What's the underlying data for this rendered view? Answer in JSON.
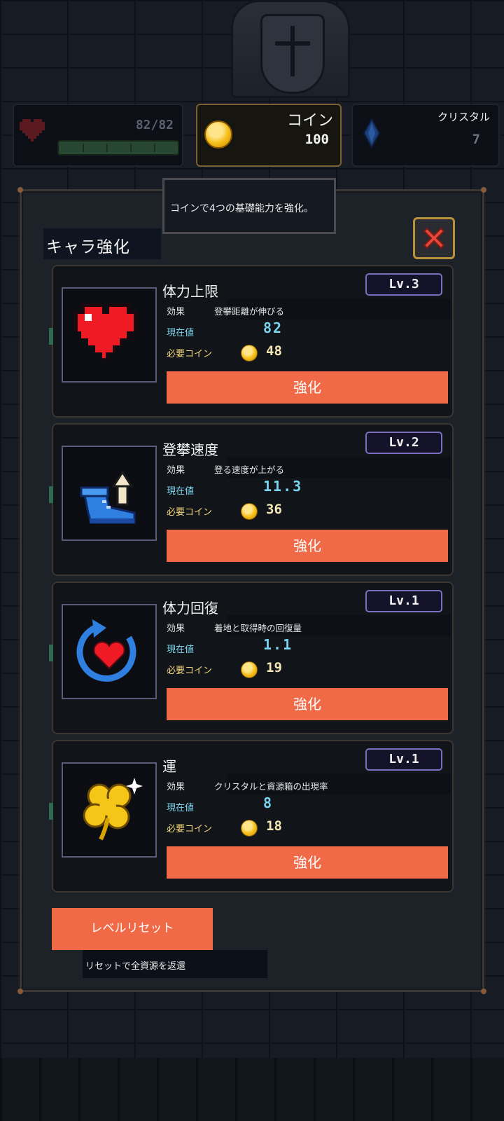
{
  "hud": {
    "hp": "82/82",
    "coin_label": "コイン",
    "coin_value": "100",
    "crystal_label": "クリスタル",
    "crystal_value": "7"
  },
  "tooltip": "コインで4つの基礎能力を強化。",
  "panel": {
    "title": "キャラ強化",
    "labels": {
      "effect": "効果",
      "current": "現在値",
      "cost": "必要コイン",
      "upgrade": "強化"
    },
    "cards": [
      {
        "name": "体力上限",
        "level": "Lv.3",
        "effect": "登攀距離が伸びる",
        "current": "82",
        "cost": "48",
        "icon": "heart-icon"
      },
      {
        "name": "登攀速度",
        "level": "Lv.2",
        "effect": "登る速度が上がる",
        "current": "11.3",
        "cost": "36",
        "icon": "boot-icon"
      },
      {
        "name": "体力回復",
        "level": "Lv.1",
        "effect": "着地と取得時の回復量",
        "current": "1.1",
        "cost": "19",
        "icon": "heal-cycle-icon"
      },
      {
        "name": "運",
        "level": "Lv.1",
        "effect": "クリスタルと資源箱の出現率",
        "current": "8",
        "cost": "18",
        "icon": "clover-icon"
      }
    ],
    "reset_button": "レベルリセット",
    "reset_note": "リセットで全資源を返還"
  },
  "colors": {
    "accent": "#f06a47",
    "level_border": "#7d6fc0",
    "current_value": "#7ad4ee",
    "coin": "#f6c01a"
  }
}
